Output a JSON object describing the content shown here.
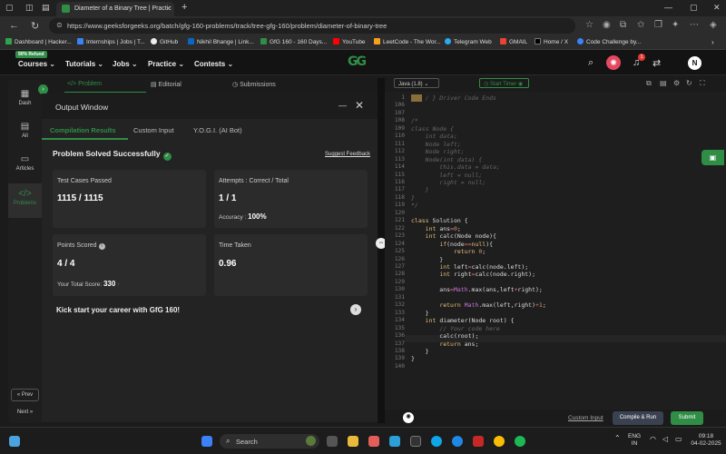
{
  "browser": {
    "tab_title": "Diameter of a Binary Tree | Practic",
    "tab_close": "×",
    "new_tab": "+",
    "url": "https://www.geeksforgeeks.org/batch/gfg-160-problems/track/tree-gfg-160/problem/diameter-of-binary-tree",
    "bookmarks": [
      {
        "label": "Dashboard | Hacker..."
      },
      {
        "label": "Internships | Jobs | T..."
      },
      {
        "label": "GitHub"
      },
      {
        "label": "Nikhil Bhange | Link..."
      },
      {
        "label": "GfG 160 - 160 Days..."
      },
      {
        "label": "YouTube"
      },
      {
        "label": "LeetCode - The Wor..."
      },
      {
        "label": "Telegram Web"
      },
      {
        "label": "GMAIL"
      },
      {
        "label": "Home / X"
      },
      {
        "label": "Code Challenge by..."
      }
    ]
  },
  "site": {
    "refund_badge": "90% Refund",
    "nav": [
      {
        "label": "Courses"
      },
      {
        "label": "Tutorials"
      },
      {
        "label": "Jobs"
      },
      {
        "label": "Practice"
      },
      {
        "label": "Contests"
      }
    ],
    "logo": "GG",
    "notification_count": "1",
    "avatar_initial": "N"
  },
  "rail": {
    "items": [
      {
        "label": "Dash"
      },
      {
        "label": "All"
      },
      {
        "label": "Articles"
      },
      {
        "label": "Problems"
      }
    ],
    "prev": "« Prev",
    "next": "Next »"
  },
  "problem_tabs": [
    {
      "label": "</> Problem"
    },
    {
      "label": "Editorial"
    },
    {
      "label": "Submissions"
    }
  ],
  "output": {
    "title": "Output Window",
    "minimize": "—",
    "close": "✕",
    "tabs": [
      {
        "label": "Compilation Results"
      },
      {
        "label": "Custom Input"
      },
      {
        "label": "Y.O.G.I. (AI Bot)"
      }
    ],
    "status": "Problem Solved Successfully",
    "suggest_feedback": "Suggest Feedback",
    "cards": {
      "test_cases_label": "Test Cases Passed",
      "test_cases_value": "1115 / 1115",
      "attempts_label": "Attempts : Correct / Total",
      "attempts_value": "1 / 1",
      "accuracy_label": "Accuracy :",
      "accuracy_value": "100%",
      "points_label": "Points Scored",
      "points_value": "4 / 4",
      "total_score_label": "Your Total Score:",
      "total_score_value": "330",
      "time_label": "Time Taken",
      "time_value": "0.96"
    },
    "cta": "Kick start your career with GfG 160!"
  },
  "editor": {
    "language": "Java (1.8)",
    "timer": "Start Timer",
    "line_numbers": [
      "1",
      "106",
      "107",
      "108",
      "109",
      "110",
      "111",
      "112",
      "113",
      "114",
      "115",
      "116",
      "117",
      "118",
      "119",
      "120",
      "121",
      "122",
      "123",
      "124",
      "125",
      "126",
      "127",
      "128",
      "129",
      "130",
      "131",
      "132",
      "133",
      "134",
      "135",
      "136",
      "137",
      "138",
      "139",
      "140"
    ],
    "custom_input": "Custom Input",
    "compile_run": "Compile & Run",
    "submit": "Submit"
  },
  "taskbar": {
    "search": "Search",
    "lang": "ENG",
    "region": "IN",
    "time": "09:18",
    "date": "04-02-2025"
  },
  "colors": {
    "accent": "#2f8d46",
    "bg": "#1b1b1b",
    "panel": "#232323",
    "card": "#2b2b2b"
  }
}
